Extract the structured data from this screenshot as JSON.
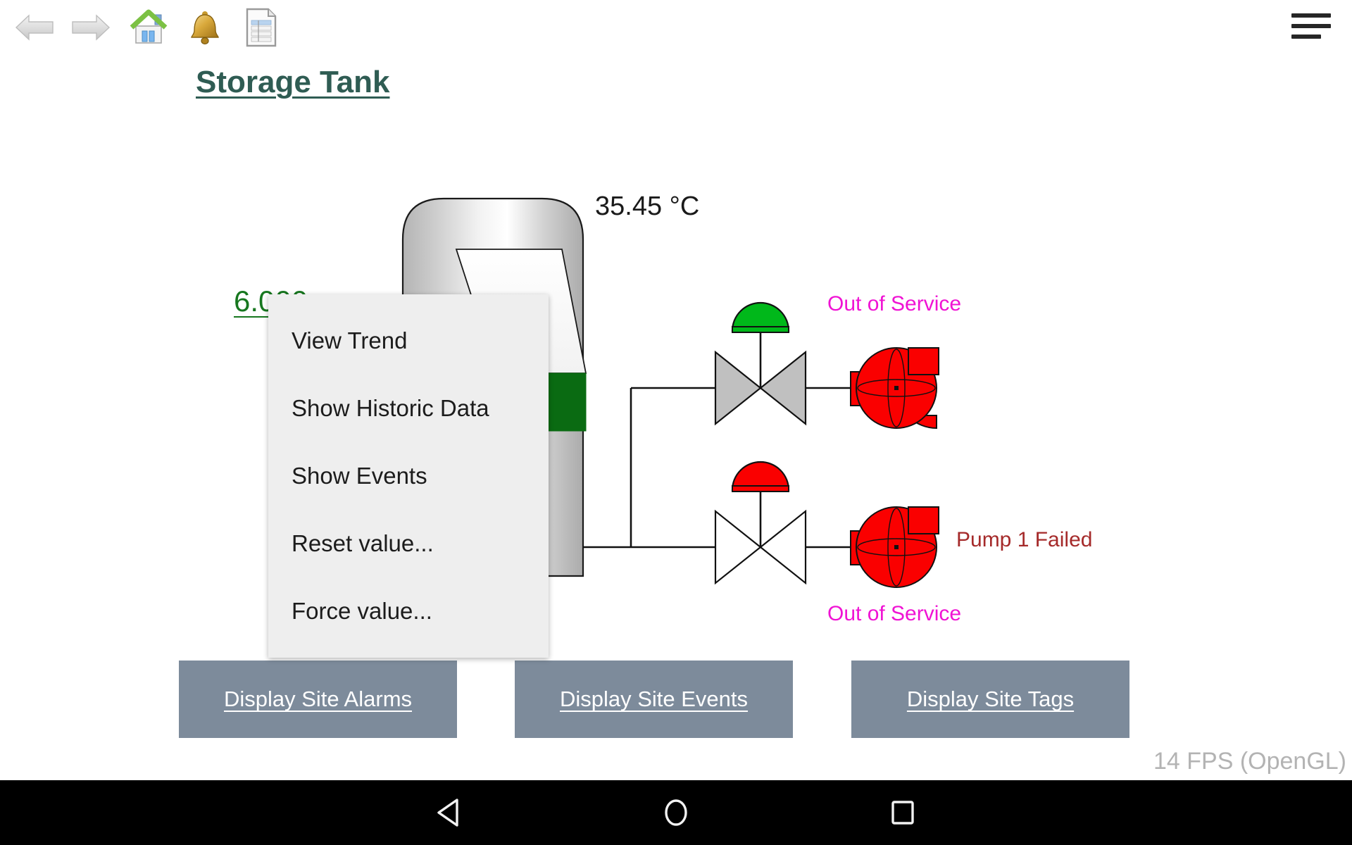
{
  "toolbar": {
    "icons": [
      {
        "name": "back-arrow-icon",
        "label": "Back"
      },
      {
        "name": "forward-arrow-icon",
        "label": "Forward"
      },
      {
        "name": "home-icon",
        "label": "Home"
      },
      {
        "name": "alarm-bell-icon",
        "label": "Alarms"
      },
      {
        "name": "report-icon",
        "label": "Reports"
      }
    ],
    "menu_icon": "hamburger-menu-icon"
  },
  "header": {
    "title": "Storage Tank"
  },
  "mimic": {
    "temperature_readout": "35.45 °C",
    "level_readout": "6.000",
    "level_readout_color": "#17771f",
    "tank": {
      "name": "storage-tank",
      "fill_color": "#0a6b12",
      "body_color": "#c4c4c4",
      "level_percent": 38
    },
    "valves": [
      {
        "name": "valve-1",
        "actuator_color": "#00b81a",
        "body_fill": "#c0c0c0",
        "state": "Open"
      },
      {
        "name": "valve-2",
        "actuator_color": "#fa0000",
        "body_fill": "#ffffff",
        "state": "Closed"
      }
    ],
    "pumps": [
      {
        "name": "pump-1",
        "color": "#fa0000"
      },
      {
        "name": "pump-2",
        "color": "#fa0000"
      }
    ],
    "status_labels": {
      "out_of_service_top": "Out of Service",
      "out_of_service_bottom": "Out of Service",
      "pump_failed": "Pump 1 Failed",
      "out_of_service_color": "#f013d4",
      "pump_failed_color": "#a52a2a"
    }
  },
  "context_menu": {
    "items": [
      {
        "label": "View Trend",
        "name": "menu-item-view-trend"
      },
      {
        "label": "Show Historic Data",
        "name": "menu-item-show-historic-data"
      },
      {
        "label": "Show Events",
        "name": "menu-item-show-events"
      },
      {
        "label": "Reset value...",
        "name": "menu-item-reset-value"
      },
      {
        "label": "Force value...",
        "name": "menu-item-force-value"
      }
    ]
  },
  "buttons": {
    "alarms": "Display Site Alarms",
    "events": "Display Site Events",
    "tags": "Display Site Tags",
    "background_color": "#7d8b9b"
  },
  "status_bar": {
    "fps": "14 FPS (OpenGL)"
  },
  "navbar": {
    "back": "back-triangle-icon",
    "home": "home-circle-icon",
    "recents": "recents-square-icon"
  }
}
